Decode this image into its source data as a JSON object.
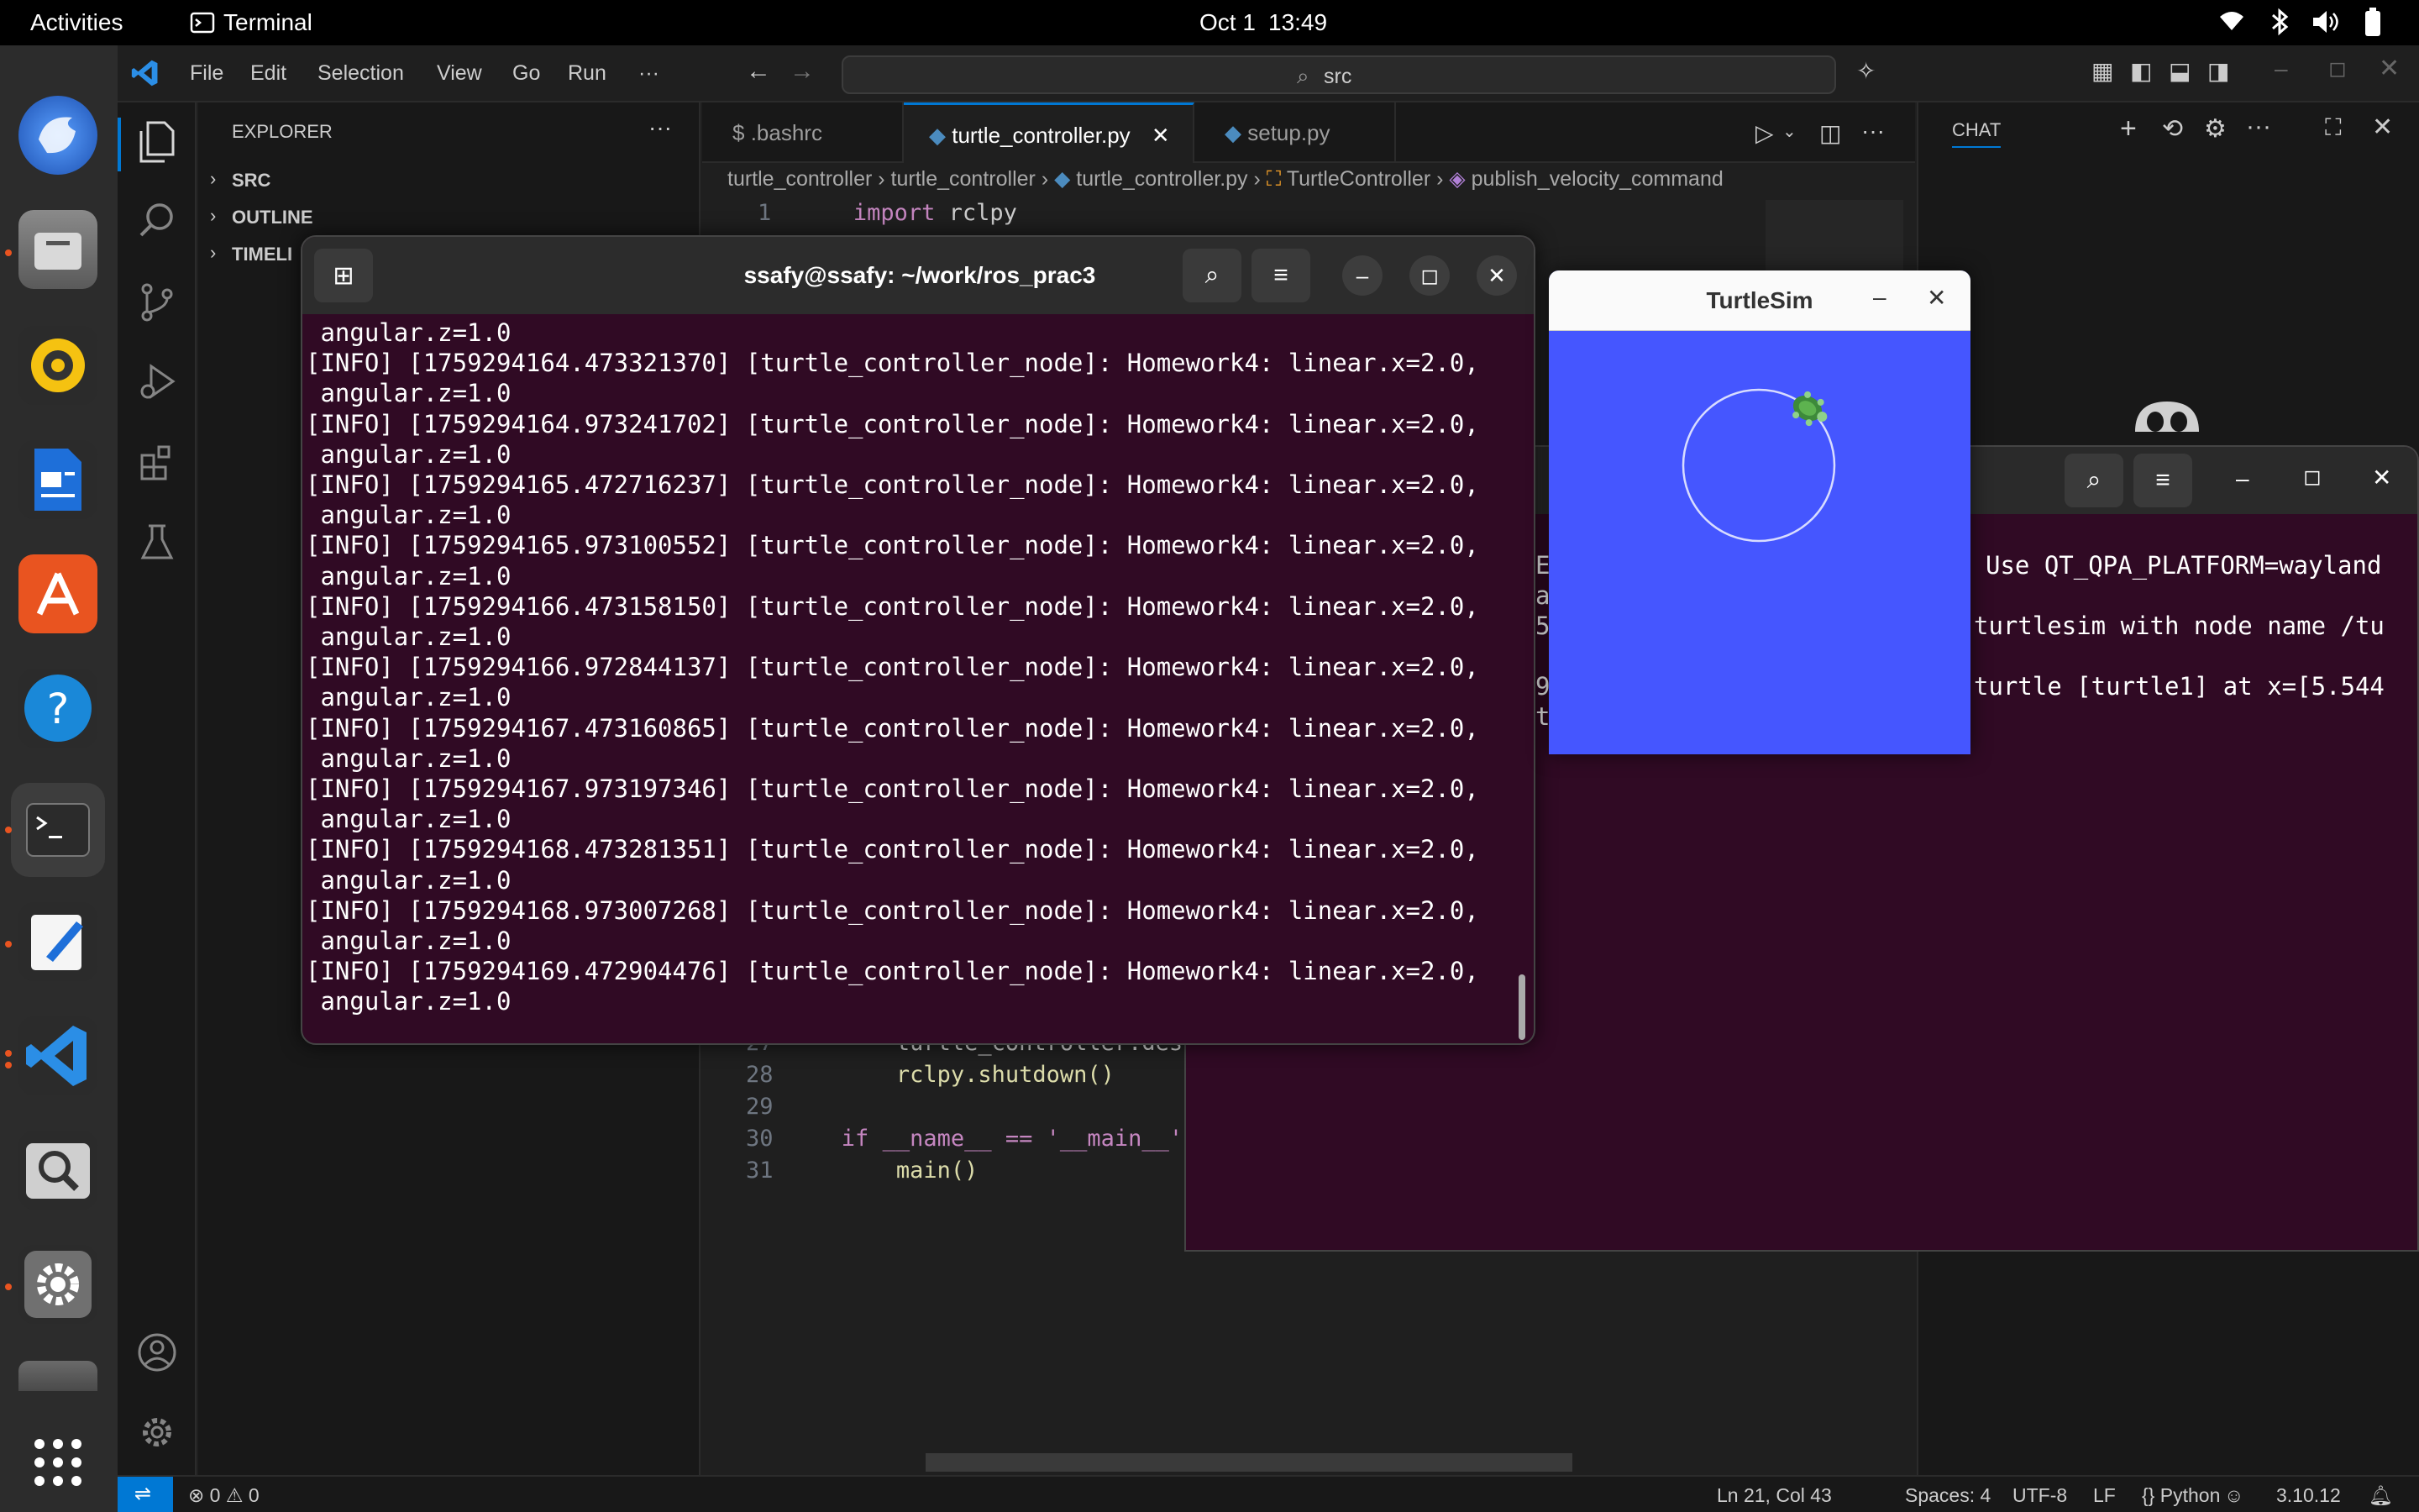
{
  "topbar": {
    "activities": "Activities",
    "app_name": "Terminal",
    "date": "Oct 1",
    "time": "13:49"
  },
  "vscode": {
    "menu": [
      "File",
      "Edit",
      "Selection",
      "View",
      "Go",
      "Run",
      "···"
    ],
    "search_text": "src",
    "explorer_title": "EXPLORER",
    "explorer_sections": [
      "SRC",
      "OUTLINE",
      "TIMELINE"
    ],
    "explorer_timeline_visible": "TIMELI",
    "tabs": [
      ".bashrc",
      "turtle_controller.py",
      "setup.py"
    ],
    "breadcrumb": [
      "turtle_controller",
      "turtle_controller",
      "turtle_controller.py",
      "TurtleController",
      "publish_velocity_command"
    ],
    "chat_title": "CHAT",
    "code_top": {
      "line": "1",
      "kw": "import",
      "rest": " rclpy"
    },
    "code_bottom": [
      {
        "n": "27",
        "text": "    turtle_controller.dest"
      },
      {
        "n": "28",
        "text": "    rclpy.shutdown()"
      },
      {
        "n": "29",
        "text": ""
      },
      {
        "n": "30",
        "text": "if __name__ == '__main__':"
      },
      {
        "n": "31",
        "text": "    main()"
      }
    ],
    "status": {
      "errors": "0",
      "warnings": "0",
      "cursor": "Ln 21, Col 43",
      "spaces": "Spaces: 4",
      "encoding": "UTF-8",
      "eol": "LF",
      "language": "Python",
      "version": "3.10.12"
    }
  },
  "terminal": {
    "title": "ssafy@ssafy: ~/work/ros_prac3",
    "first_line": " angular.z=1.0",
    "entries": [
      {
        "ts": "1759294164.473321370"
      },
      {
        "ts": "1759294164.973241702"
      },
      {
        "ts": "1759294165.472716237"
      },
      {
        "ts": "1759294165.973100552"
      },
      {
        "ts": "1759294166.473158150"
      },
      {
        "ts": "1759294166.972844137"
      },
      {
        "ts": "1759294167.473160865"
      },
      {
        "ts": "1759294167.973197346"
      },
      {
        "ts": "1759294168.473281351"
      },
      {
        "ts": "1759294168.973007268"
      },
      {
        "ts": "1759294169.472904476"
      }
    ],
    "level": "[INFO]",
    "node": "[turtle_controller_node]:",
    "message": "Homework4: linear.x=2.0,",
    "continuation": " angular.z=1.0"
  },
  "turtlesim": {
    "title": "TurtleSim",
    "background": "#4556ff"
  },
  "terminal2": {
    "lines": [
      "Use QT_QPA_PLATFORM=wayland",
      "turtlesim with node name /tu",
      "turtle [turtle1] at x=[5.544"
    ],
    "partial_left": [
      "E",
      "a",
      "5",
      "",
      "9",
      "t"
    ]
  }
}
